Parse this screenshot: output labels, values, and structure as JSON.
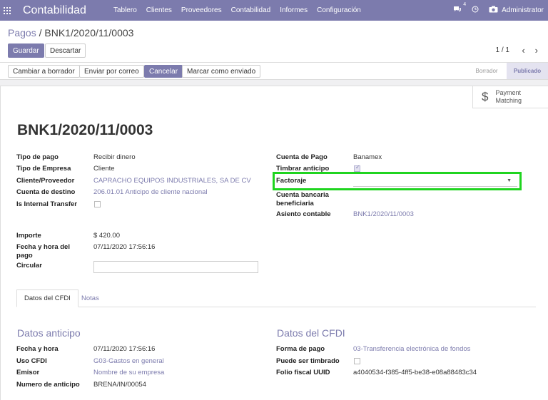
{
  "navbar": {
    "brand": "Contabilidad",
    "menu": [
      "Tablero",
      "Clientes",
      "Proveedores",
      "Contabilidad",
      "Informes",
      "Configuración"
    ],
    "chat_badge": "4",
    "user": "Administrator"
  },
  "breadcrumb": {
    "parent": "Pagos",
    "separator": "/",
    "current": "BNK1/2020/11/0003"
  },
  "toolbar": {
    "save": "Guardar",
    "discard": "Descartar"
  },
  "pager": {
    "value": "1 / 1"
  },
  "actions": {
    "to_draft": "Cambiar a borrador",
    "send_email": "Enviar por correo",
    "cancel": "Cancelar",
    "mark_sent": "Marcar como enviado"
  },
  "states": {
    "draft": "Borrador",
    "posted": "Publicado"
  },
  "smart_button": {
    "line1": "Payment",
    "line2": "Matching"
  },
  "record": {
    "title": "BNK1/2020/11/0003",
    "left": {
      "payment_type_label": "Tipo de pago",
      "payment_type": "Recibir dinero",
      "partner_type_label": "Tipo de Empresa",
      "partner_type": "Cliente",
      "partner_label": "Cliente/Proveedor",
      "partner": "CAPRACHO EQUIPOS INDUSTRIALES, SA DE CV",
      "dest_account_label": "Cuenta de destino",
      "dest_account": "206.01.01 Anticipo de cliente nacional",
      "internal_transfer_label": "Is Internal Transfer",
      "amount_label": "Importe",
      "amount": "$ 420.00",
      "date_label_1": "Fecha y hora del",
      "date_label_2": "pago",
      "date": "07/11/2020 17:56:16",
      "circular_label": "Circular"
    },
    "right": {
      "journal_label": "Cuenta de Pago",
      "journal": "Banamex",
      "stamp_label": "Timbrar anticipo",
      "factoring_label": "Factoraje",
      "factoring": "",
      "bank_account_label_1": "Cuenta bancaria",
      "bank_account_label_2": "beneficiaria",
      "move_label": "Asiento contable",
      "move": "BNK1/2020/11/0003"
    }
  },
  "tabs": {
    "cfdi": "Datos del CFDI",
    "notes": "Notas"
  },
  "advance": {
    "title": "Datos anticipo",
    "datetime_label": "Fecha y hora",
    "datetime": "07/11/2020 17:56:16",
    "cfdi_use_label": "Uso CFDI",
    "cfdi_use": "G03-Gastos en general",
    "issuer_label": "Emisor",
    "issuer": "Nombre de su empresa",
    "number_label": "Numero de anticipo",
    "number": "BRENA/IN/00054"
  },
  "cfdi": {
    "title": "Datos del CFDI",
    "payment_form_label": "Forma de pago",
    "payment_form": "03-Transferencia electrónica de fondos",
    "stampable_label": "Puede ser timbrado",
    "uuid_label": "Folio fiscal UUID",
    "uuid": "a4040534-f385-4ff5-be38-e08a88483c34"
  },
  "colors": {
    "brand": "#7c7bad",
    "highlight": "#1fd41f"
  }
}
